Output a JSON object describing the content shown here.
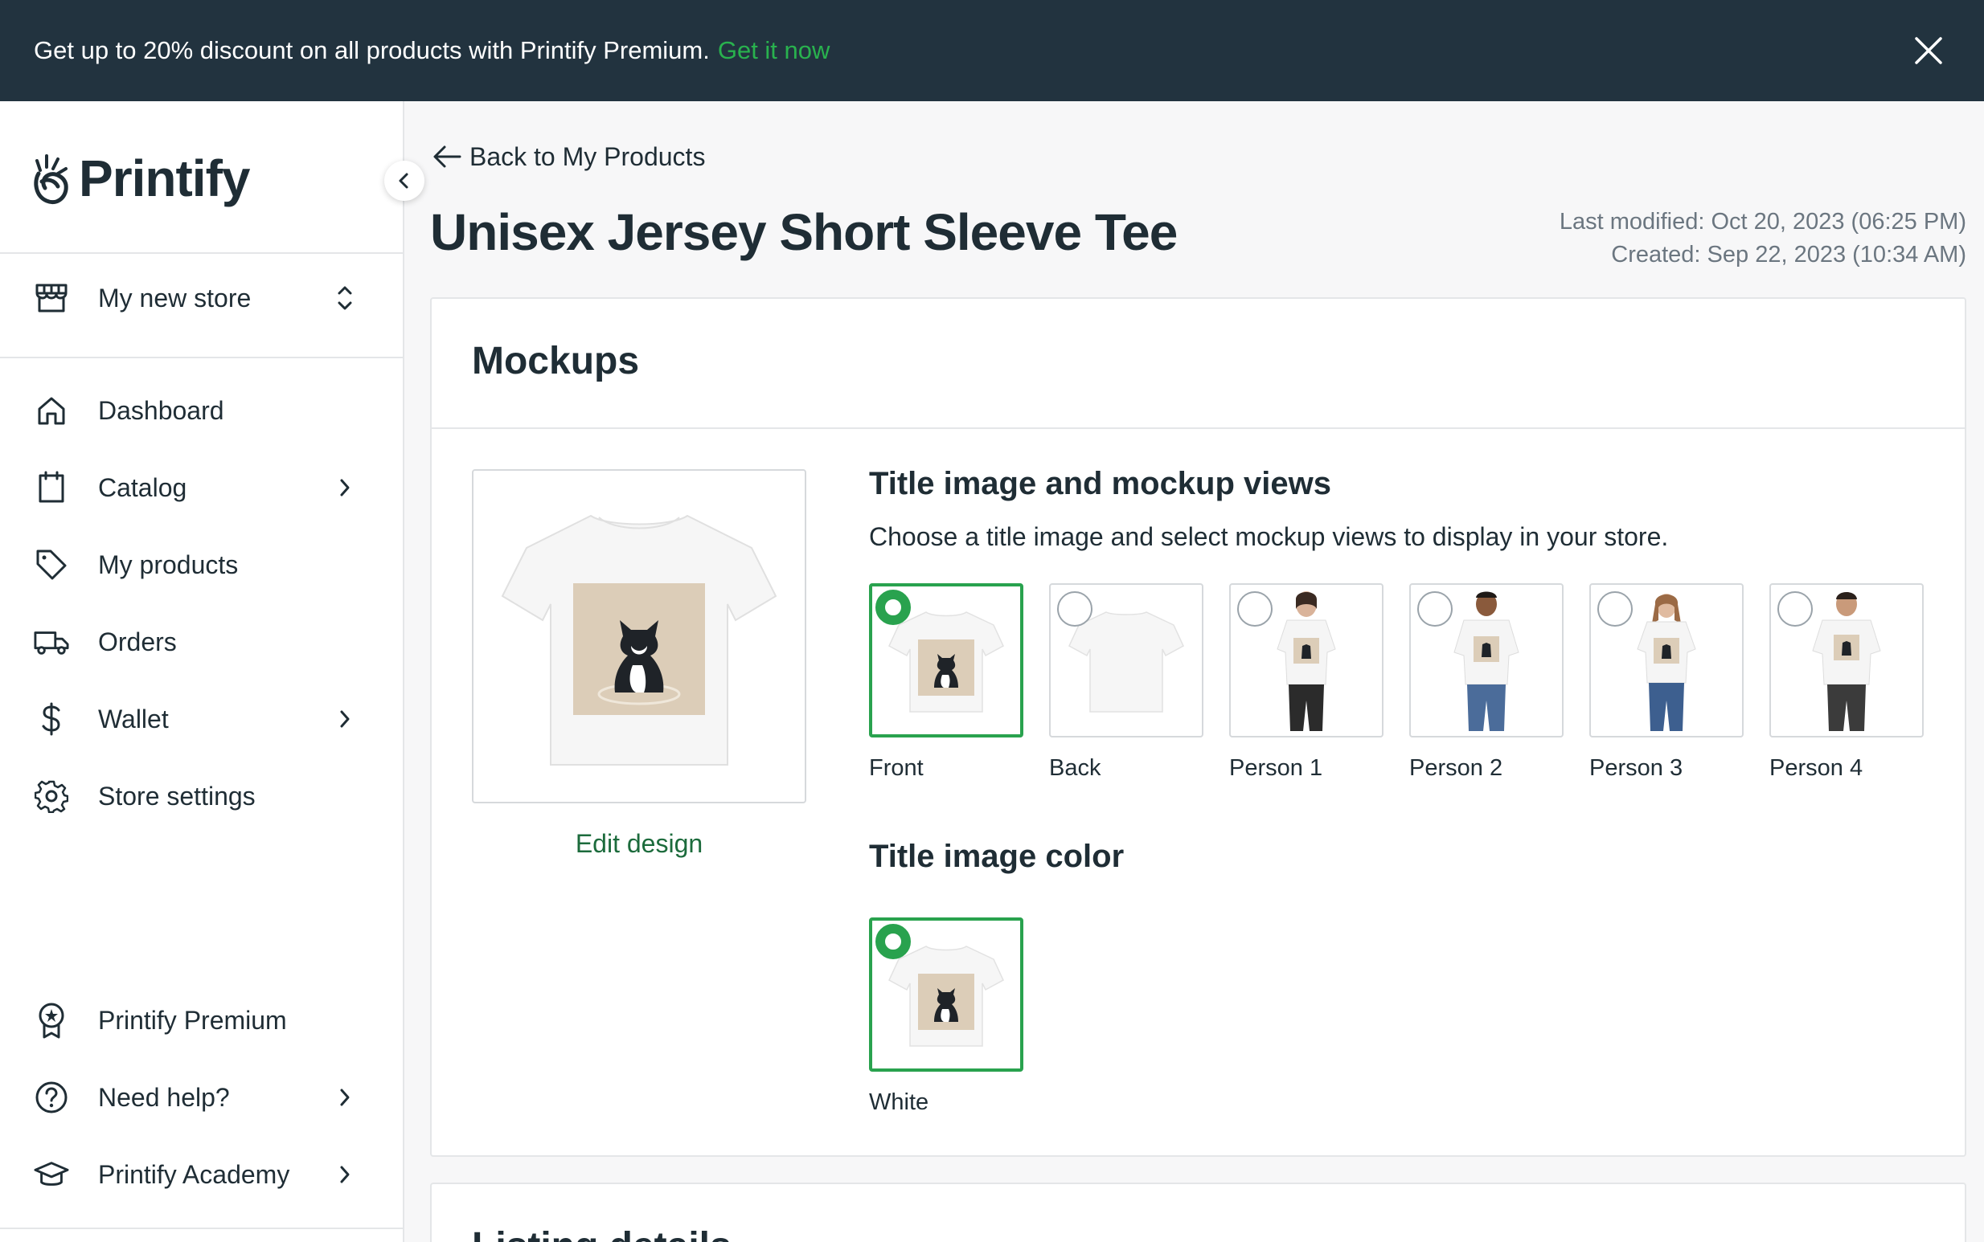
{
  "banner": {
    "text": "Get up to 20% discount on all products with Printify Premium.",
    "link": "Get it now",
    "colors": {
      "background": "#22333f",
      "link": "#29b24e"
    }
  },
  "sidebar": {
    "logo": "Printify",
    "store": {
      "label": "My new store",
      "icon": "store-icon"
    },
    "nav": [
      {
        "label": "Dashboard",
        "icon": "home-icon"
      },
      {
        "label": "Catalog",
        "icon": "clipboard-icon"
      },
      {
        "label": "My products",
        "icon": "tag-icon"
      },
      {
        "label": "Orders",
        "icon": "truck-icon"
      },
      {
        "label": "Wallet",
        "icon": "dollar-icon"
      },
      {
        "label": "Store settings",
        "icon": "gear-icon"
      }
    ],
    "bottom": [
      {
        "label": "Printify Premium",
        "icon": "award-icon"
      },
      {
        "label": "Need help?",
        "icon": "help-icon"
      },
      {
        "label": "Printify Academy",
        "icon": "graduation-cap-icon"
      }
    ]
  },
  "main": {
    "back_link": "Back to My Products",
    "title": "Unisex Jersey Short Sleeve Tee",
    "last_modified": "Last modified: Oct 20, 2023 (06:25 PM)",
    "created": "Created: Sep 22, 2023 (10:34 AM)",
    "mockups": {
      "title": "Mockups",
      "edit_design": "Edit design",
      "views_title": "Title image and mockup views",
      "views_subtitle": "Choose a title image and select mockup views to display in your store.",
      "views": [
        {
          "label": "Front",
          "selected": true
        },
        {
          "label": "Back",
          "selected": false
        },
        {
          "label": "Person 1",
          "selected": false
        },
        {
          "label": "Person 2",
          "selected": false
        },
        {
          "label": "Person 3",
          "selected": false
        },
        {
          "label": "Person 4",
          "selected": false
        }
      ],
      "color_title": "Title image color",
      "colors": [
        {
          "label": "White",
          "selected": true
        }
      ],
      "accent": "#29a24e"
    },
    "listing_title": "Listing details"
  }
}
